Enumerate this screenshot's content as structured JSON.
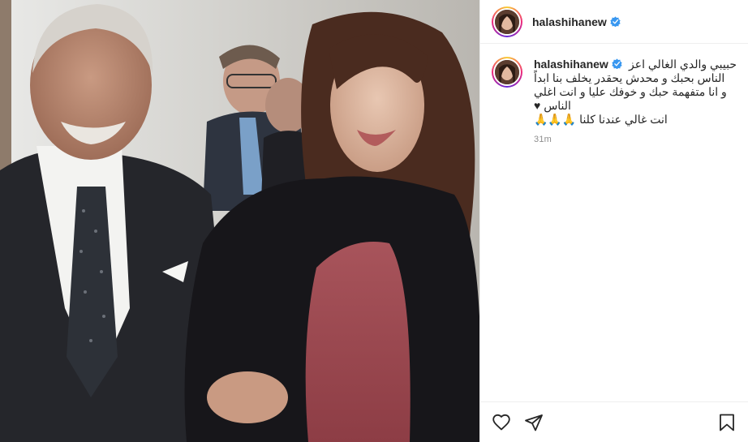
{
  "post": {
    "username": "halashihanew",
    "verified": true,
    "caption_first_line": "حبيبي والدي الغالي اعز",
    "caption_lines": [
      "الناس بحبك و محدش يحقدر يخلف بنا ابداً",
      "و انا متفهمة حبك و خوفك عليا و انت اغلي",
      "الناس ♥",
      "انت غالي عندنا كلنا 🙏🙏🙏"
    ],
    "time_ago": "31m"
  },
  "icons": {
    "verified": "verified-badge-icon",
    "like": "heart-icon",
    "share": "paper-plane-icon",
    "save": "bookmark-icon"
  },
  "colors": {
    "verified": "#3897f0",
    "text": "#262626",
    "muted": "#8e8e8e",
    "border": "#efefef"
  }
}
